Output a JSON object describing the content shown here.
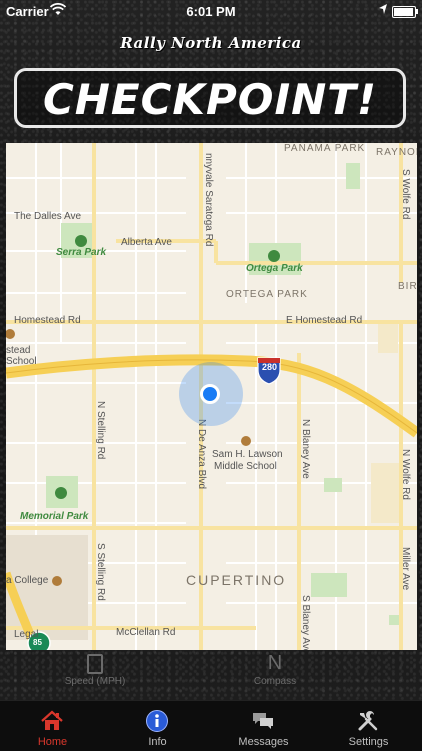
{
  "status_bar": {
    "carrier": "Carrier",
    "time": "6:01 PM"
  },
  "header": {
    "brand": "Rally North America",
    "title": "CHECKPOINT!"
  },
  "map": {
    "labels": {
      "panama_park": "PANAMA PARK",
      "raynor": "RAYNOR",
      "the_dalles": "The Dalles Ave",
      "serra_park": "Serra Park",
      "alberta_ave": "Alberta Ave",
      "ortega_park": "Ortega Park",
      "ortega_park_area": "ORTEGA PARK",
      "bir": "BIR",
      "homestead_rd_w": "Homestead Rd",
      "homestead_rd_e": "E Homestead Rd",
      "homestead_school_1": "stead",
      "homestead_school_2": "School",
      "hwy_280": "280",
      "sam_lawson_1": "Sam H. Lawson",
      "sam_lawson_2": "Middle School",
      "memorial_park": "Memorial Park",
      "cupertino": "CUPERTINO",
      "college": "a College",
      "mcclellan": "McClellan Rd",
      "legal": "Legal",
      "hwy_85": "85",
      "saratoga_rd": "nnyvale Saratoga Rd",
      "de_anza": "N De Anza Blvd",
      "n_stelling": "N Stelling Rd",
      "n_blaney": "N Blaney Ave",
      "s_blaney": "S Blaney Ave",
      "n_wolfe": "N Wolfe Rd",
      "s_wolfe": "S Wolfe Rd",
      "s_stelling": "S Stelling Rd",
      "miller": "Miller Ave"
    }
  },
  "gauges": {
    "speed_label": "Speed (MPH)",
    "compass_value": "N",
    "compass_label": "Compass"
  },
  "tabs": [
    {
      "label": "Home",
      "icon": "home-icon"
    },
    {
      "label": "Info",
      "icon": "info-icon"
    },
    {
      "label": "Messages",
      "icon": "messages-icon"
    },
    {
      "label": "Settings",
      "icon": "settings-icon"
    }
  ],
  "colors": {
    "active_tab": "#d9372c",
    "map_bg": "#f4efe4",
    "highway": "#f6cf55",
    "location_dot": "#1a7cf5"
  }
}
